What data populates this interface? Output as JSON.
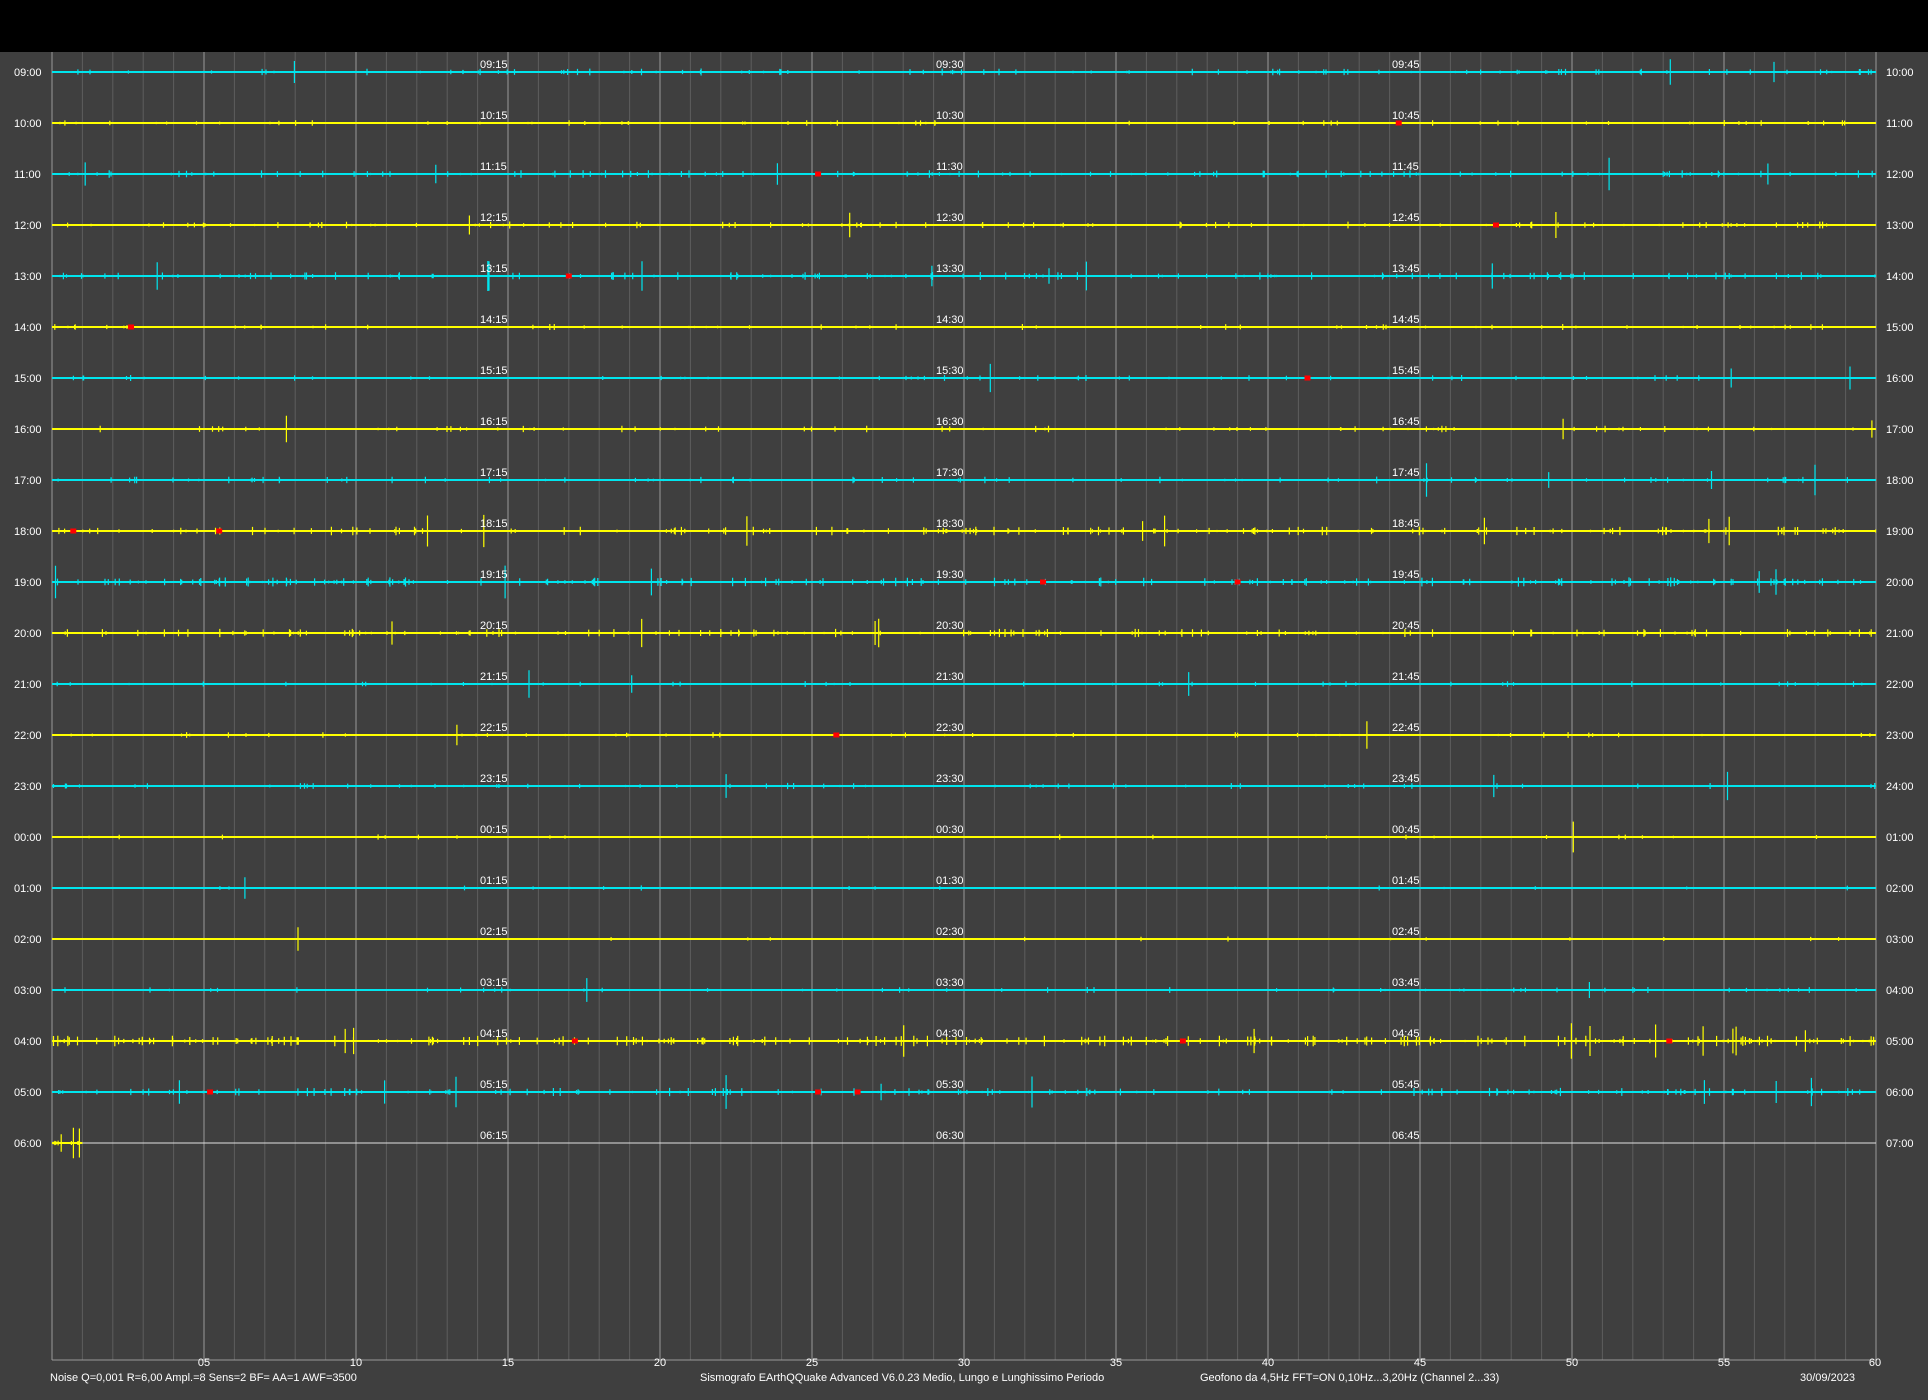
{
  "window": {
    "date": "30/09/2023"
  },
  "footer": {
    "left": "Noise Q=0,001 R=6,00 Ampl.=8 Sens=2 BF= AA=1 AWF=3500",
    "center": "Sismografo  EArthQQuake Advanced V6.0.23  Medio, Lungo e Lunghissimo Periodo",
    "right": "Geofono da 4,5Hz FFT=ON 0,10Hz...3,20Hz       (Channel 2...33)",
    "date": "30/09/2023"
  },
  "colors": {
    "background": "#3f3f3f",
    "trace_a": "#00e5ee",
    "trace_b": "#ffff00",
    "event": "#ff0000",
    "grid_major": "#9a9a9a",
    "grid_minor": "#5e5e5e",
    "text": "#ffffff"
  },
  "chart_data": {
    "type": "line",
    "subtype": "helicorder",
    "x_unit": "minutes",
    "xlim": [
      0,
      60
    ],
    "x_tick_labels": [
      "05",
      "10",
      "15",
      "20",
      "25",
      "30",
      "35",
      "40",
      "45",
      "50",
      "55",
      "60"
    ],
    "rows": [
      {
        "start": "09:00",
        "end": "10:00",
        "q15": "09:15",
        "q30": "09:30",
        "q45": "09:45",
        "color": "cyan",
        "activity": 0.35,
        "events_min": []
      },
      {
        "start": "10:00",
        "end": "11:00",
        "q15": "10:15",
        "q30": "10:30",
        "q45": "10:45",
        "color": "yellow",
        "activity": 0.2,
        "events_min": [
          44.3
        ]
      },
      {
        "start": "11:00",
        "end": "12:00",
        "q15": "11:15",
        "q30": "11:30",
        "q45": "11:45",
        "color": "cyan",
        "activity": 0.45,
        "events_min": [
          25.2
        ]
      },
      {
        "start": "12:00",
        "end": "13:00",
        "q15": "12:15",
        "q30": "12:30",
        "q45": "12:45",
        "color": "yellow",
        "activity": 0.35,
        "events_min": [
          47.5
        ]
      },
      {
        "start": "13:00",
        "end": "14:00",
        "q15": "13:15",
        "q30": "13:30",
        "q45": "13:45",
        "color": "cyan",
        "activity": 0.5,
        "events_min": [
          17.0
        ]
      },
      {
        "start": "14:00",
        "end": "15:00",
        "q15": "14:15",
        "q30": "14:30",
        "q45": "14:45",
        "color": "yellow",
        "activity": 0.2,
        "events_min": [
          2.6
        ]
      },
      {
        "start": "15:00",
        "end": "16:00",
        "q15": "15:15",
        "q30": "15:30",
        "q45": "15:45",
        "color": "cyan",
        "activity": 0.2,
        "events_min": [
          41.3
        ]
      },
      {
        "start": "16:00",
        "end": "17:00",
        "q15": "16:15",
        "q30": "16:30",
        "q45": "16:45",
        "color": "yellow",
        "activity": 0.25,
        "events_min": []
      },
      {
        "start": "17:00",
        "end": "18:00",
        "q15": "17:15",
        "q30": "17:30",
        "q45": "17:45",
        "color": "cyan",
        "activity": 0.3,
        "events_min": []
      },
      {
        "start": "18:00",
        "end": "19:00",
        "q15": "18:15",
        "q30": "18:30",
        "q45": "18:45",
        "color": "yellow",
        "activity": 0.6,
        "events_min": [
          0.7,
          5.5
        ]
      },
      {
        "start": "19:00",
        "end": "20:00",
        "q15": "19:15",
        "q30": "19:30",
        "q45": "19:45",
        "color": "cyan",
        "activity": 0.7,
        "events_min": [
          32.6,
          39.0
        ]
      },
      {
        "start": "20:00",
        "end": "21:00",
        "q15": "20:15",
        "q30": "20:30",
        "q45": "20:45",
        "color": "yellow",
        "activity": 0.55,
        "events_min": []
      },
      {
        "start": "21:00",
        "end": "22:00",
        "q15": "21:15",
        "q30": "21:30",
        "q45": "21:45",
        "color": "cyan",
        "activity": 0.15,
        "events_min": []
      },
      {
        "start": "22:00",
        "end": "23:00",
        "q15": "22:15",
        "q30": "22:30",
        "q45": "22:45",
        "color": "yellow",
        "activity": 0.15,
        "events_min": [
          25.8
        ]
      },
      {
        "start": "23:00",
        "end": "24:00",
        "q15": "23:15",
        "q30": "23:30",
        "q45": "23:45",
        "color": "cyan",
        "activity": 0.2,
        "events_min": []
      },
      {
        "start": "00:00",
        "end": "01:00",
        "q15": "00:15",
        "q30": "00:30",
        "q45": "00:45",
        "color": "yellow",
        "activity": 0.08,
        "events_min": []
      },
      {
        "start": "01:00",
        "end": "02:00",
        "q15": "01:15",
        "q30": "01:30",
        "q45": "01:45",
        "color": "cyan",
        "activity": 0.05,
        "events_min": []
      },
      {
        "start": "02:00",
        "end": "03:00",
        "q15": "02:15",
        "q30": "02:30",
        "q45": "02:45",
        "color": "yellow",
        "activity": 0.03,
        "events_min": []
      },
      {
        "start": "03:00",
        "end": "04:00",
        "q15": "03:15",
        "q30": "03:30",
        "q45": "03:45",
        "color": "cyan",
        "activity": 0.2,
        "events_min": []
      },
      {
        "start": "04:00",
        "end": "05:00",
        "q15": "04:15",
        "q30": "04:30",
        "q45": "04:45",
        "color": "yellow",
        "activity": 0.95,
        "events_min": [
          17.2,
          37.2,
          53.2
        ]
      },
      {
        "start": "05:00",
        "end": "06:00",
        "q15": "05:15",
        "q30": "05:30",
        "q45": "05:45",
        "color": "cyan",
        "activity": 0.55,
        "events_min": [
          5.2,
          25.2,
          26.5
        ]
      },
      {
        "start": "06:00",
        "end": "07:00",
        "q15": "06:15",
        "q30": "06:30",
        "q45": "06:45",
        "color": "yellow",
        "activity": 0.0,
        "partial_until_min": 1.0,
        "events_min": []
      }
    ]
  }
}
